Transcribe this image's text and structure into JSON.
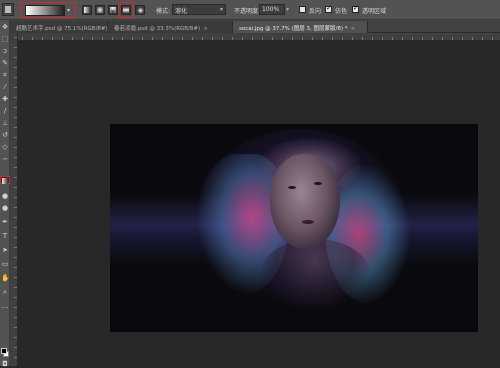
{
  "options_bar": {
    "mode_label": "模式:",
    "mode_value": "溶化",
    "opacity_label": "不透明度:",
    "opacity_value": "100%",
    "reverse_label": "反向",
    "dither_label": "仿色",
    "transparency_label": "透明区域",
    "reverse_checked": false,
    "dither_checked": true,
    "transparency_checked": true
  },
  "tabs": [
    {
      "label": "超酷艺术字.psd @ 75.1%(RGB/8#)",
      "close": "×"
    },
    {
      "label": "春若凌眉.psd @ 33.3%(RGB/8#)",
      "close": "×"
    },
    {
      "label": "socai.jpg @ 37.7% (图层 3, 图层蒙版/8) *",
      "close": "×"
    }
  ],
  "toolbar": {
    "tools": [
      "move-tool",
      "marquee-tool",
      "lasso-tool",
      "quick-select-tool",
      "crop-tool",
      "eyedropper-tool",
      "healing-brush-tool",
      "brush-tool",
      "clone-stamp-tool",
      "history-brush-tool",
      "eraser-tool",
      "gradient-tool",
      "blur-tool",
      "dodge-tool",
      "pen-tool",
      "type-tool",
      "path-select-tool",
      "shape-tool",
      "hand-tool",
      "zoom-tool",
      "more-tools"
    ],
    "active_tool": "gradient-tool",
    "foreground_color": "#000000",
    "background_color": "#ffffff"
  },
  "colors": {
    "highlight": "#d52a2a",
    "ui_bg": "#535353",
    "workspace": "#282828"
  }
}
